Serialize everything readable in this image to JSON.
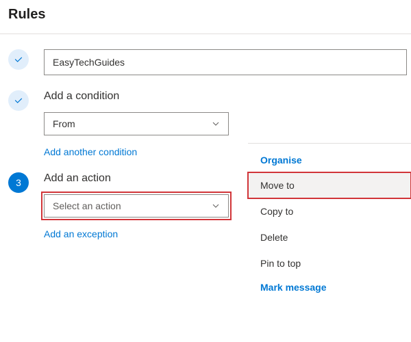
{
  "colors": {
    "accent": "#0078d4",
    "highlight": "#d13438"
  },
  "header": {
    "title": "Rules"
  },
  "step1": {
    "name_value": "EasyTechGuides"
  },
  "step2": {
    "title": "Add a condition",
    "condition_select_value": "From",
    "add_another_link": "Add another condition"
  },
  "step3": {
    "number": "3",
    "title": "Add an action",
    "action_select_placeholder": "Select an action",
    "add_exception_link": "Add an exception"
  },
  "action_menu": {
    "section1_label": "Organise",
    "items": [
      "Move to",
      "Copy to",
      "Delete",
      "Pin to top"
    ],
    "section2_label": "Mark message"
  }
}
